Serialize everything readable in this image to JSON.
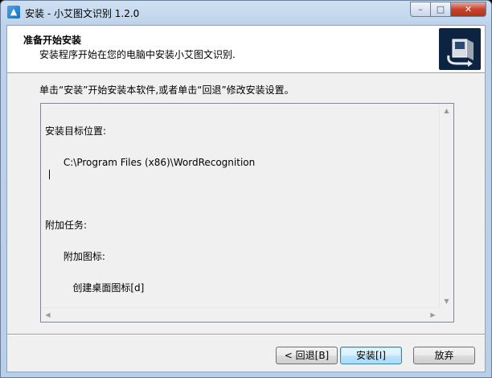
{
  "window": {
    "title": "安装 - 小艾图文识别 1.2.0",
    "caption_buttons": {
      "minimize": "–",
      "maximize": "□",
      "close": "✕"
    }
  },
  "header": {
    "title": "准备开始安装",
    "subtitle": "安装程序开始在您的电脑中安装小艾图文识别."
  },
  "instruction": "单击“安装”开始安装本软件,或者单击“回退”修改安装设置。",
  "summary": {
    "lines": [
      "安装目标位置:",
      "      C:\\Program Files (x86)\\WordRecognition",
      "",
      "附加任务:",
      "      附加图标:",
      "         创建桌面图标[d]"
    ]
  },
  "buttons": {
    "back": "< 回退[B]",
    "install": "安装[I]",
    "cancel": "放弃"
  },
  "icons": {
    "app": "installer-icon",
    "header_logo": "setup-computer-logo"
  }
}
